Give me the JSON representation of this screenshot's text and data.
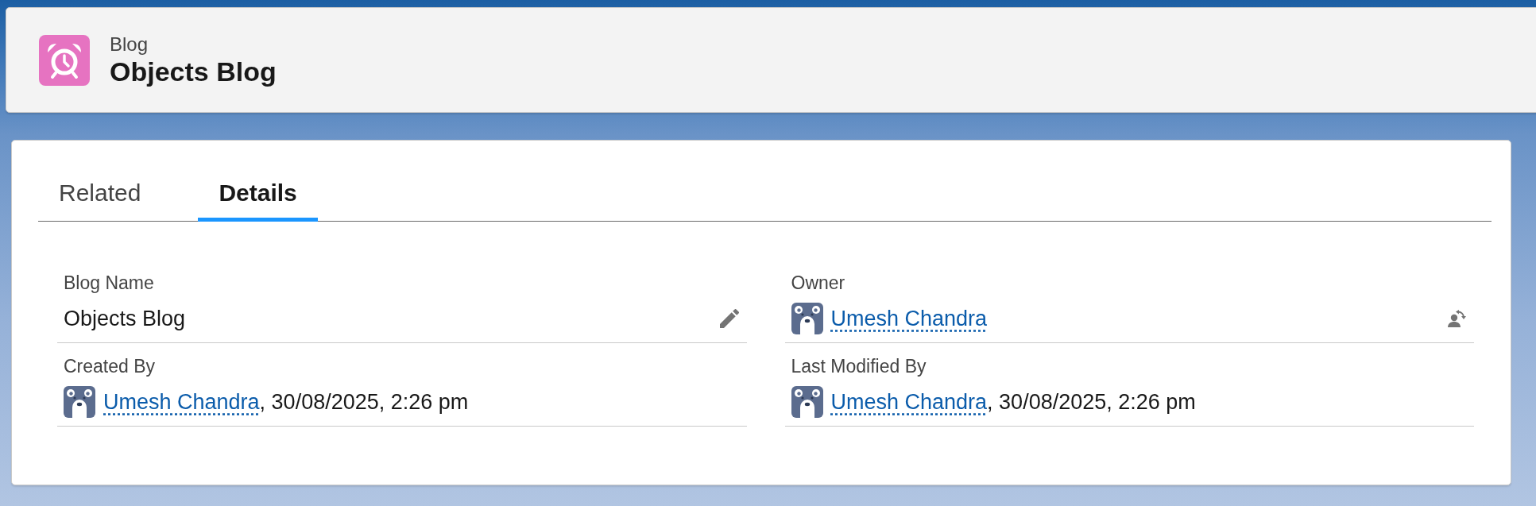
{
  "header": {
    "object_type": "Blog",
    "title": "Objects Blog"
  },
  "tabs": [
    {
      "label": "Related",
      "selected": false
    },
    {
      "label": "Details",
      "selected": true
    }
  ],
  "fields": [
    {
      "label": "Blog Name",
      "kind": "editable",
      "value": "Objects Blog"
    },
    {
      "label": "Owner",
      "kind": "owner",
      "user": "Umesh Chandra"
    },
    {
      "label": "Created By",
      "kind": "audit",
      "user": "Umesh Chandra",
      "timestamp": ", 30/08/2025, 2:26 pm"
    },
    {
      "label": "Last Modified By",
      "kind": "audit",
      "user": "Umesh Chandra",
      "timestamp": ", 30/08/2025, 2:26 pm"
    }
  ]
}
